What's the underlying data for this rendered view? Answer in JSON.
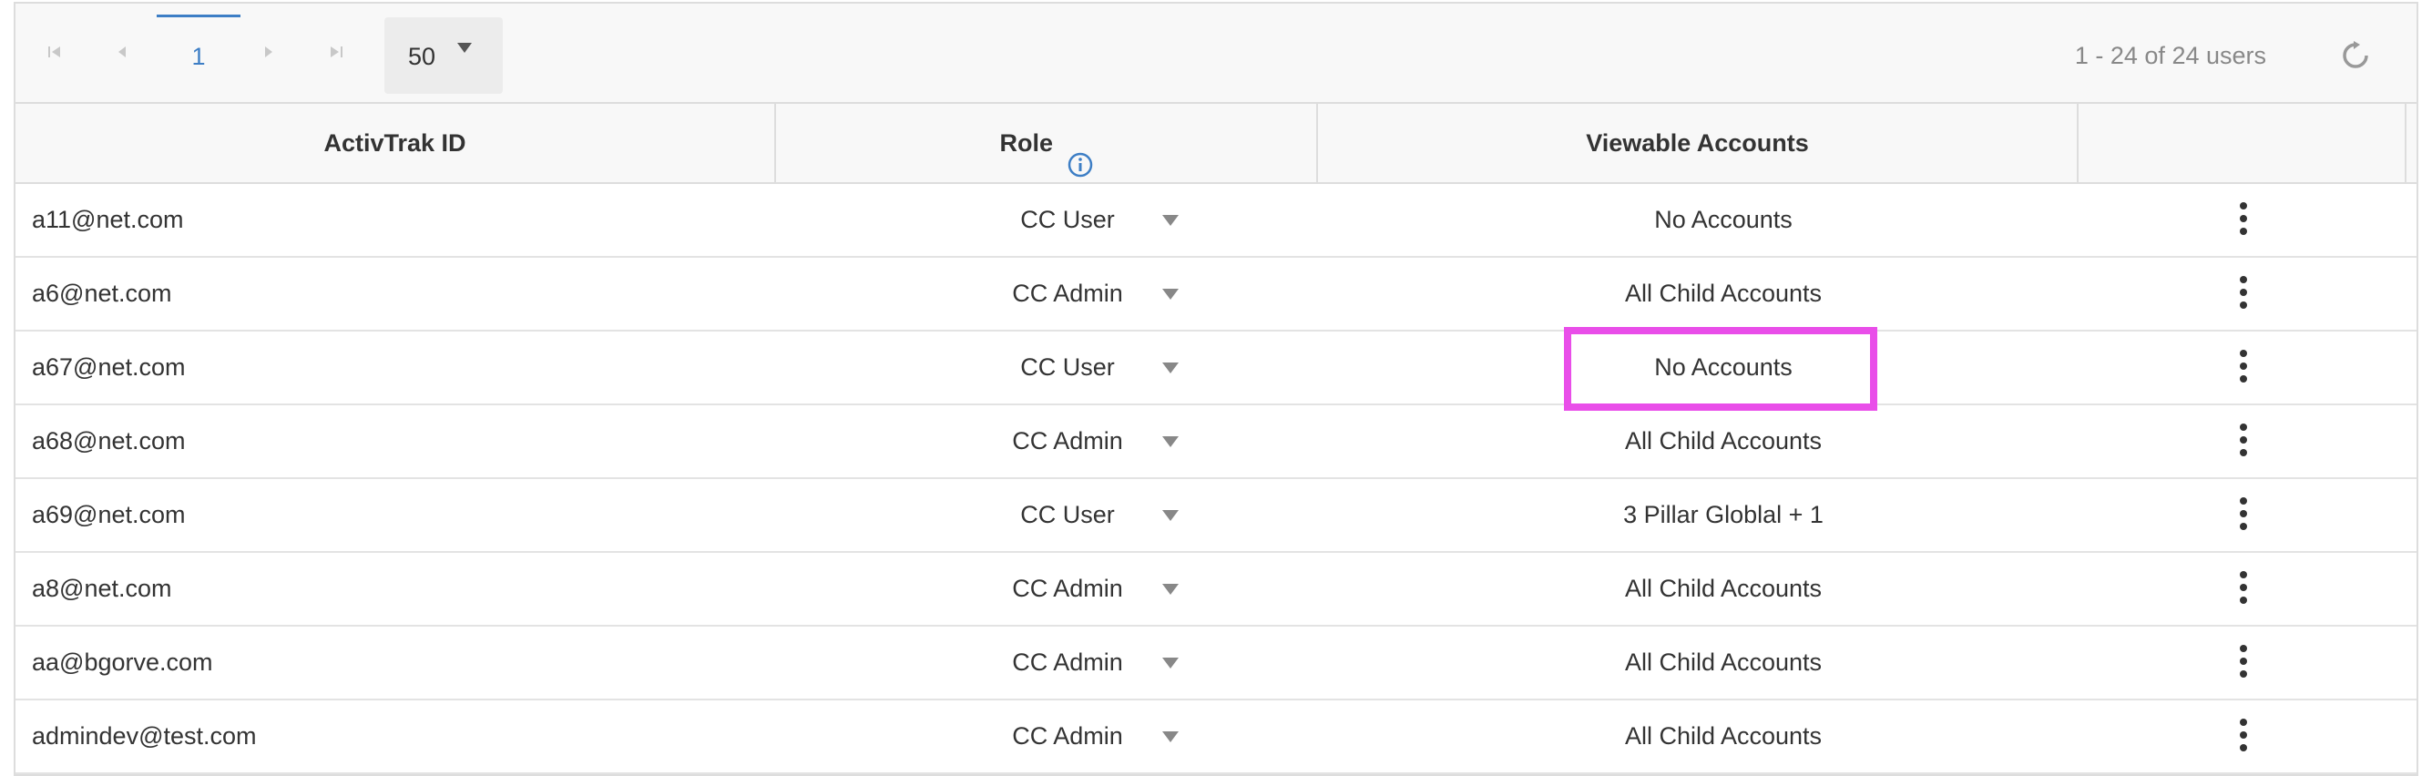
{
  "pager": {
    "first_icon": "first-page-icon",
    "prev_icon": "prev-page-icon",
    "current_page": "1",
    "next_icon": "next-page-icon",
    "last_icon": "last-page-icon",
    "page_size": "50",
    "count_text": "1 - 24 of 24 users",
    "refresh_icon": "refresh-icon"
  },
  "table": {
    "columns": [
      "ActivTrak ID",
      "Role",
      "Viewable Accounts",
      ""
    ],
    "role_info_icon": "info-icon",
    "rows": [
      {
        "id": "a11@net.com",
        "role": "CC User",
        "accounts": "No Accounts"
      },
      {
        "id": "a6@net.com",
        "role": "CC Admin",
        "accounts": "All Child Accounts"
      },
      {
        "id": "a67@net.com",
        "role": "CC User",
        "accounts": "No Accounts"
      },
      {
        "id": "a68@net.com",
        "role": "CC Admin",
        "accounts": "All Child Accounts"
      },
      {
        "id": "a69@net.com",
        "role": "CC User",
        "accounts": "3 Pillar Globlal + 1"
      },
      {
        "id": "a8@net.com",
        "role": "CC Admin",
        "accounts": "All Child Accounts"
      },
      {
        "id": "aa@bgorve.com",
        "role": "CC Admin",
        "accounts": "All Child Accounts"
      },
      {
        "id": "admindev@test.com",
        "role": "CC Admin",
        "accounts": "All Child Accounts"
      }
    ]
  },
  "colors": {
    "accent": "#3d7ec5",
    "highlight": "#e94ee9"
  }
}
